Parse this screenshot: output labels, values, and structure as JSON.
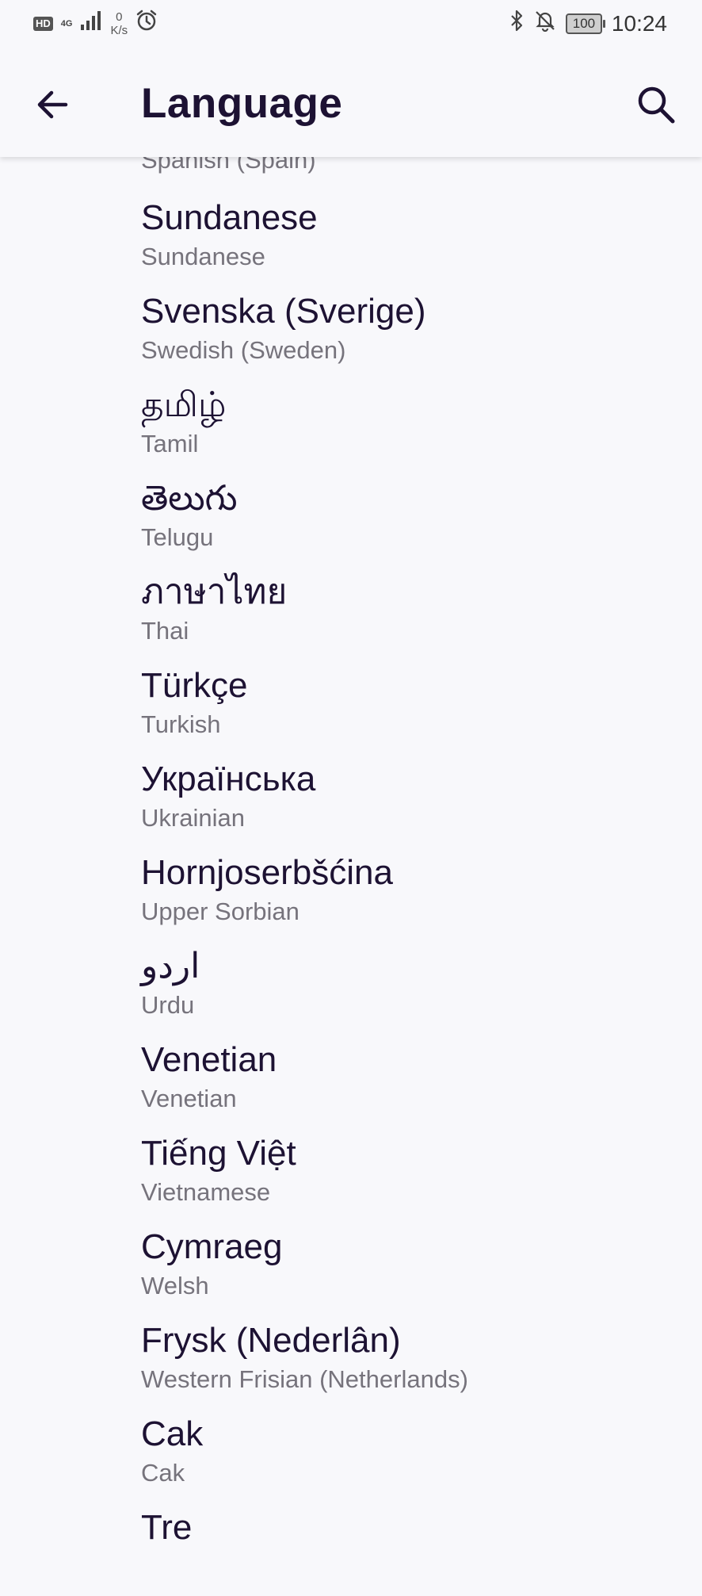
{
  "status_bar": {
    "hd": "HD",
    "network": "4G",
    "speed_value": "0",
    "speed_unit": "K/s",
    "battery": "100",
    "time": "10:24"
  },
  "header": {
    "title": "Language"
  },
  "partial_item_subtitle": "Spanish (Spain)",
  "languages": [
    {
      "native": "Sundanese",
      "english": "Sundanese"
    },
    {
      "native": "Svenska (Sverige)",
      "english": "Swedish (Sweden)"
    },
    {
      "native": "தமிழ்",
      "english": "Tamil"
    },
    {
      "native": "తెలుగు",
      "english": "Telugu"
    },
    {
      "native": "ภาษาไทย",
      "english": "Thai"
    },
    {
      "native": "Türkçe",
      "english": "Turkish"
    },
    {
      "native": "Українська",
      "english": "Ukrainian"
    },
    {
      "native": "Hornjoserbšćina",
      "english": "Upper Sorbian"
    },
    {
      "native": "اردو",
      "english": "Urdu"
    },
    {
      "native": "Venetian",
      "english": "Venetian"
    },
    {
      "native": "Tiếng Việt",
      "english": "Vietnamese"
    },
    {
      "native": "Cymraeg",
      "english": "Welsh"
    },
    {
      "native": "Frysk (Nederlân)",
      "english": "Western Frisian (Netherlands)"
    },
    {
      "native": "Cak",
      "english": "Cak"
    },
    {
      "native": "Tre",
      "english": ""
    }
  ],
  "icons": {
    "back": "arrow-back-icon",
    "search": "search-icon",
    "bluetooth": "bluetooth-icon",
    "silent": "bell-off-icon",
    "alarm": "alarm-icon",
    "signal": "signal-icon"
  },
  "colors": {
    "background": "#f8f8fb",
    "title_text": "#1d1233",
    "subtitle_text": "#76737c"
  }
}
